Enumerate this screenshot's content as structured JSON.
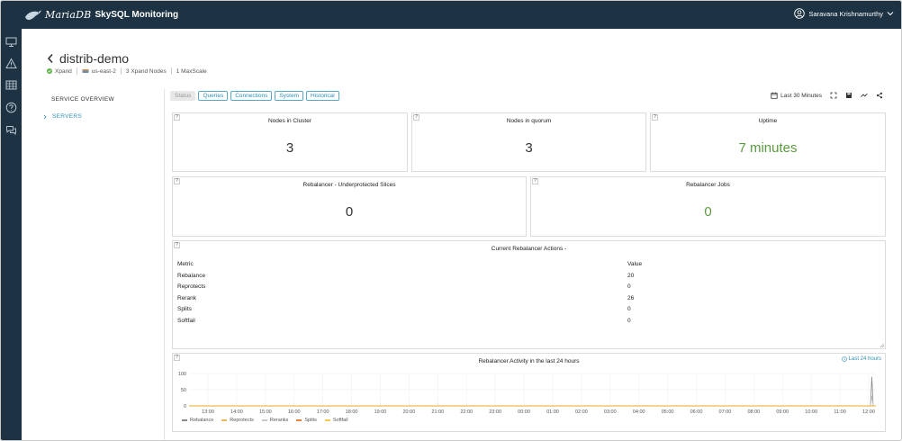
{
  "header": {
    "logo_text": "MariaDB",
    "product_name": "SkySQL Monitoring",
    "user_name": "Saravana Krishnamurthy",
    "bg_color": "#1d3343"
  },
  "sidebar": {
    "icons": [
      "monitor-icon",
      "alert-icon",
      "table-icon",
      "help-icon",
      "chat-icon"
    ]
  },
  "page": {
    "title": "distrib-demo",
    "meta": {
      "status": "Xpand",
      "region": "us-east-2",
      "nodes": "3 Xpand Nodes",
      "maxscale": "1 MaxScale"
    }
  },
  "leftnav": {
    "overview": "SERVICE OVERVIEW",
    "servers": "SERVERS"
  },
  "tabs": [
    "Status",
    "Queries",
    "Connections",
    "System",
    "Historical"
  ],
  "toolbar": {
    "time_range": "Last 30 Minutes"
  },
  "panels": {
    "nodes_in_cluster": {
      "title": "Nodes in Cluster",
      "value": "3"
    },
    "nodes_in_quorum": {
      "title": "Nodes in quorum",
      "value": "3"
    },
    "uptime": {
      "title": "Uptime",
      "value": "7 minutes"
    },
    "underprotected": {
      "title": "Rebalancer - Underprotected Slices",
      "value": "0"
    },
    "jobs": {
      "title": "Rebalancer Jobs",
      "value": "0"
    },
    "help_mark": "?"
  },
  "actions": {
    "title": "Current Rebalancer Actions",
    "title_suffix": "-",
    "col_metric": "Metric",
    "col_value": "Value",
    "rows": [
      {
        "metric": "Rebalance",
        "value": "20"
      },
      {
        "metric": "Reprotects",
        "value": "0"
      },
      {
        "metric": "Rerank",
        "value": "26"
      },
      {
        "metric": "Splits",
        "value": "0"
      },
      {
        "metric": "Softfail",
        "value": "0"
      }
    ]
  },
  "activity": {
    "title": "Rebalancer Activity in the last 24 hours",
    "range_link": "Last 24 hours",
    "legend": [
      {
        "name": "Rebalance",
        "color": "#888888"
      },
      {
        "name": "Reprotects",
        "color": "#f0b85a"
      },
      {
        "name": "Reranks",
        "color": "#c8c8c8"
      },
      {
        "name": "Splits",
        "color": "#e8803c"
      },
      {
        "name": "Softfail",
        "color": "#f2c94c"
      }
    ]
  },
  "chart_data": {
    "type": "line",
    "title": "Rebalancer Activity in the last 24 hours",
    "xlabel": "",
    "ylabel": "",
    "ylim": [
      0,
      100
    ],
    "yticks": [
      "100",
      "50",
      "0"
    ],
    "x": [
      "13:00",
      "14:00",
      "15:00",
      "16:00",
      "17:00",
      "18:00",
      "19:00",
      "20:00",
      "21:00",
      "22:00",
      "23:00",
      "00:00",
      "01:00",
      "02:00",
      "03:00",
      "04:00",
      "05:00",
      "06:00",
      "07:00",
      "08:00",
      "09:00",
      "10:00",
      "11:00",
      "12:00"
    ],
    "series": [
      {
        "name": "Rebalance",
        "values": [
          0,
          0,
          0,
          0,
          0,
          0,
          0,
          0,
          0,
          0,
          0,
          0,
          0,
          0,
          0,
          0,
          0,
          0,
          0,
          0,
          0,
          0,
          0,
          90
        ]
      },
      {
        "name": "Reprotects",
        "values": [
          0,
          0,
          0,
          0,
          0,
          0,
          0,
          0,
          0,
          0,
          0,
          0,
          0,
          0,
          0,
          0,
          0,
          0,
          0,
          0,
          0,
          0,
          0,
          0
        ]
      },
      {
        "name": "Reranks",
        "values": [
          0,
          0,
          0,
          0,
          0,
          0,
          0,
          0,
          0,
          0,
          0,
          0,
          0,
          0,
          0,
          0,
          0,
          0,
          0,
          0,
          0,
          0,
          0,
          30
        ]
      },
      {
        "name": "Splits",
        "values": [
          0,
          0,
          0,
          0,
          0,
          0,
          0,
          0,
          0,
          0,
          0,
          0,
          0,
          0,
          0,
          0,
          0,
          0,
          0,
          0,
          0,
          0,
          0,
          0
        ]
      },
      {
        "name": "Softfail",
        "values": [
          0,
          0,
          0,
          0,
          0,
          0,
          0,
          0,
          0,
          0,
          0,
          0,
          0,
          0,
          0,
          0,
          0,
          0,
          0,
          0,
          0,
          0,
          0,
          0
        ]
      }
    ],
    "grid": true,
    "legend_position": "bottom-left"
  }
}
